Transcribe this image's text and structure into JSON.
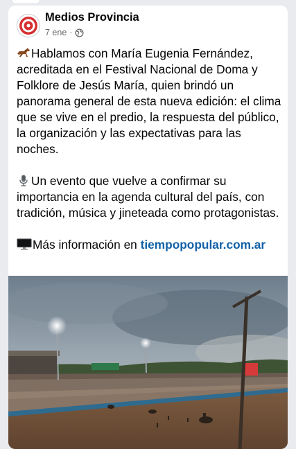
{
  "post": {
    "page_name": "Medios Provincia",
    "date": "7 ene",
    "separator": "·",
    "audience_icon": "globe-icon",
    "paragraph1": "Hablamos con María Eugenia Fernández, acreditada en el Festival Nacional de Doma y Folklore de Jesús María, quien brindó un panorama general de esta nueva edición: el clima que se vive en el predio, la respuesta del público, la organización y las expectativas para las noches.",
    "paragraph1_icon": "horse-icon",
    "paragraph2": "Un evento que vuelve a confirmar su importancia en la agenda cultural del país, con tradición, música y jineteada como protagonistas.",
    "paragraph2_icon": "microphone-icon",
    "paragraph3_prefix": "Más información en ",
    "paragraph3_icon": "desktop-computer-icon",
    "link_text": "tiempopopular.com.ar",
    "link_color": "#1161a8",
    "photo_subject": "rodeo-arena-photo"
  }
}
